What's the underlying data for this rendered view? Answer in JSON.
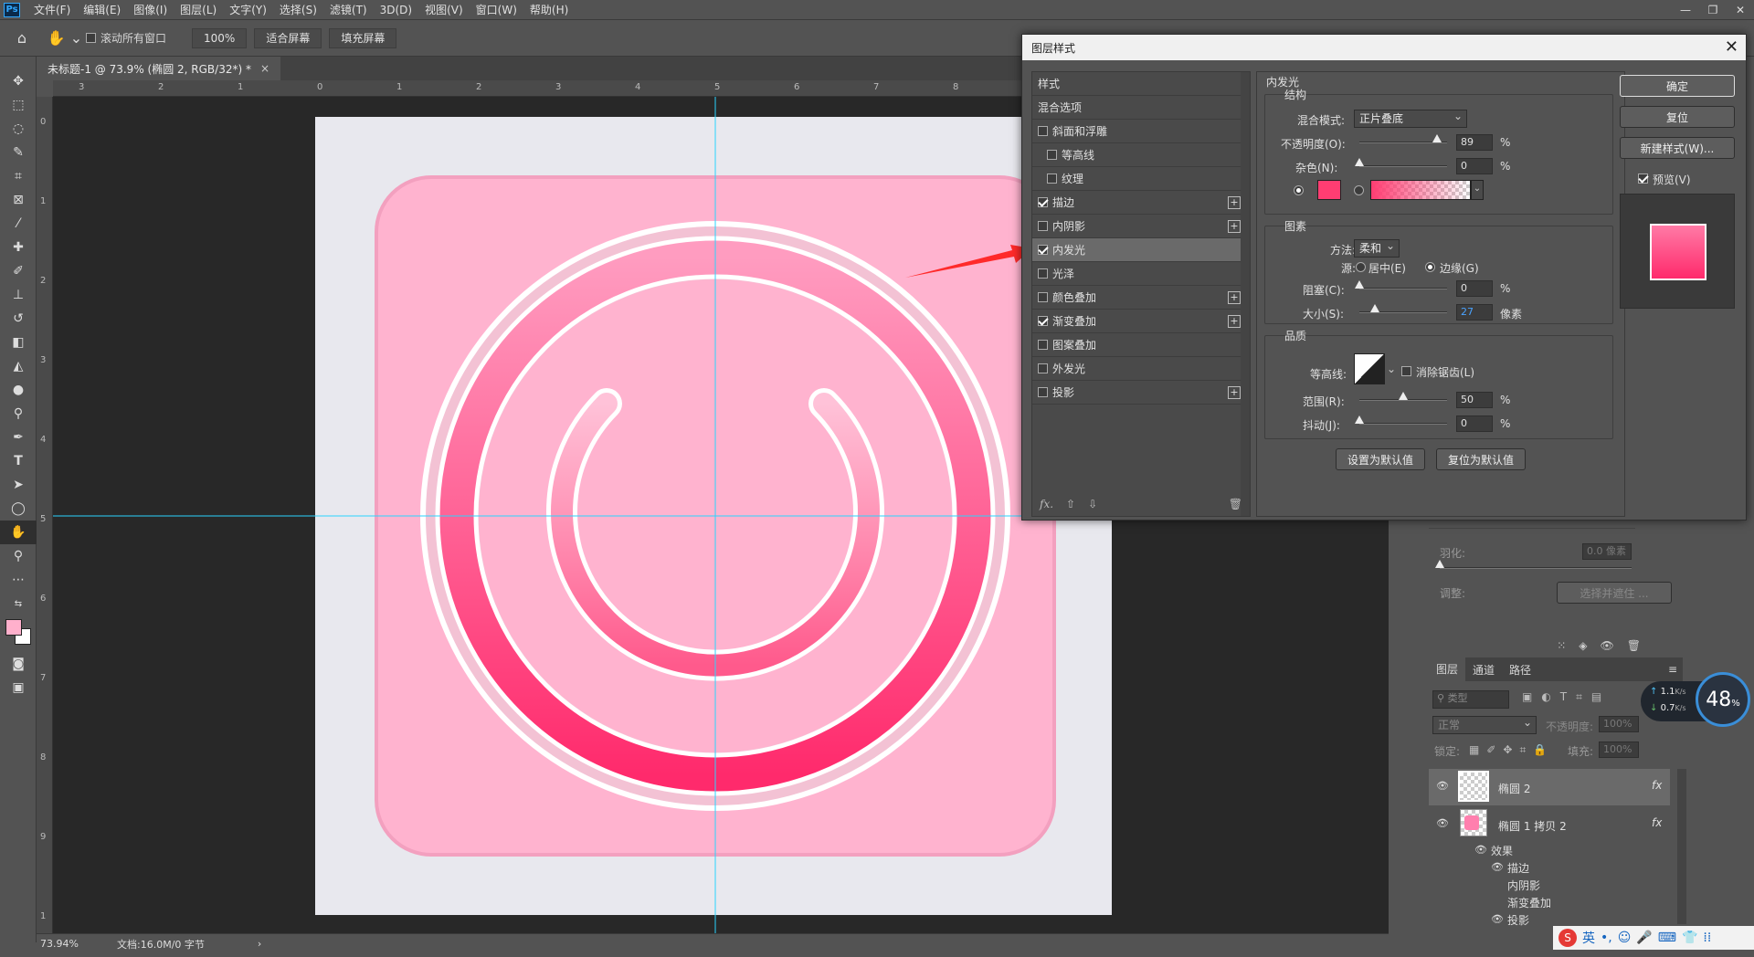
{
  "menu": {
    "logo": "Ps",
    "items": [
      "文件(F)",
      "编辑(E)",
      "图像(I)",
      "图层(L)",
      "文字(Y)",
      "选择(S)",
      "滤镜(T)",
      "3D(D)",
      "视图(V)",
      "窗口(W)",
      "帮助(H)"
    ]
  },
  "options": {
    "scroll_all_label": "滚动所有窗口",
    "zoom_button": "100%",
    "fit_button": "适合屏幕",
    "fill_button": "填充屏幕"
  },
  "document": {
    "tab_title": "未标题-1 @ 73.9% (椭圆 2, RGB/32*) *",
    "ruler_top_labels": [
      "3",
      "2",
      "1",
      "0",
      "1",
      "2",
      "3",
      "4",
      "5",
      "6",
      "7",
      "8"
    ],
    "ruler_left_labels": [
      "0",
      "1",
      "2",
      "3",
      "4",
      "5",
      "6",
      "7",
      "8",
      "9",
      "1"
    ]
  },
  "status": {
    "zoom": "73.94%",
    "doc_info": "文档:16.0M/0 字节"
  },
  "dialog": {
    "title": "图层样式",
    "styles_header": "样式",
    "blend_options": "混合选项",
    "items": [
      {
        "label": "斜面和浮雕",
        "checked": false,
        "sub": false,
        "plus": false
      },
      {
        "label": "等高线",
        "checked": false,
        "sub": true,
        "plus": false
      },
      {
        "label": "纹理",
        "checked": false,
        "sub": true,
        "plus": false
      },
      {
        "label": "描边",
        "checked": true,
        "sub": false,
        "plus": true
      },
      {
        "label": "内阴影",
        "checked": false,
        "sub": false,
        "plus": true
      },
      {
        "label": "内发光",
        "checked": true,
        "sub": false,
        "plus": false,
        "selected": true
      },
      {
        "label": "光泽",
        "checked": false,
        "sub": false,
        "plus": false
      },
      {
        "label": "颜色叠加",
        "checked": false,
        "sub": false,
        "plus": true
      },
      {
        "label": "渐变叠加",
        "checked": true,
        "sub": false,
        "plus": true
      },
      {
        "label": "图案叠加",
        "checked": false,
        "sub": false,
        "plus": false
      },
      {
        "label": "外发光",
        "checked": false,
        "sub": false,
        "plus": false
      },
      {
        "label": "投影",
        "checked": false,
        "sub": false,
        "plus": true
      }
    ],
    "fx_label": "fx.",
    "section_title": "内发光",
    "structure": {
      "title": "结构",
      "blend_mode_label": "混合模式:",
      "blend_mode_value": "正片叠底",
      "opacity_label": "不透明度(O):",
      "opacity_value": "89",
      "noise_label": "杂色(N):",
      "noise_value": "0",
      "color": "#ff3d72",
      "opacity_pct": 0.89,
      "noise_pct": 0
    },
    "elements": {
      "title": "图素",
      "method_label": "方法:",
      "method_value": "柔和",
      "source_label": "源:",
      "source_center": "居中(E)",
      "source_edge": "边缘(G)",
      "choke_label": "阻塞(C):",
      "choke_value": "0",
      "size_label": "大小(S):",
      "size_value": "27",
      "size_unit": "像素",
      "choke_pct": 0,
      "size_pct": 0.18
    },
    "quality": {
      "title": "品质",
      "contour_label": "等高线:",
      "antialias_label": "消除锯齿(L)",
      "range_label": "范围(R):",
      "range_value": "50",
      "jitter_label": "抖动(J):",
      "jitter_value": "0",
      "range_pct": 0.5,
      "jitter_pct": 0
    },
    "percent": "%",
    "set_default": "设置为默认值",
    "reset_default": "复位为默认值",
    "ok": "确定",
    "reset": "复位",
    "new_style": "新建样式(W)...",
    "preview": "预览(V)"
  },
  "properties": {
    "feather_label": "羽化:",
    "feather_value": "0.0 像素",
    "adjust_label": "调整:",
    "select_mask": "选择并遮住 ..."
  },
  "layers": {
    "tabs": [
      "图层",
      "通道",
      "路径"
    ],
    "search_placeholder": "类型",
    "blend": "正常",
    "opacity_label": "不透明度:",
    "opacity_value": "100%",
    "lock_label": "锁定:",
    "fill_label": "填充:",
    "fill_value": "100%",
    "rows": [
      {
        "name": "椭圆 2"
      },
      {
        "name": "椭圆 1 拷贝 2"
      }
    ],
    "effects_label": "效果",
    "effects": [
      "描边",
      "内阴影",
      "渐变叠加",
      "投影"
    ]
  },
  "netmon": {
    "up": "1.1",
    "down": "0.7",
    "unit": "K/s",
    "percent": "48",
    "pct_sign": "%"
  },
  "ime": {
    "label": "英"
  }
}
